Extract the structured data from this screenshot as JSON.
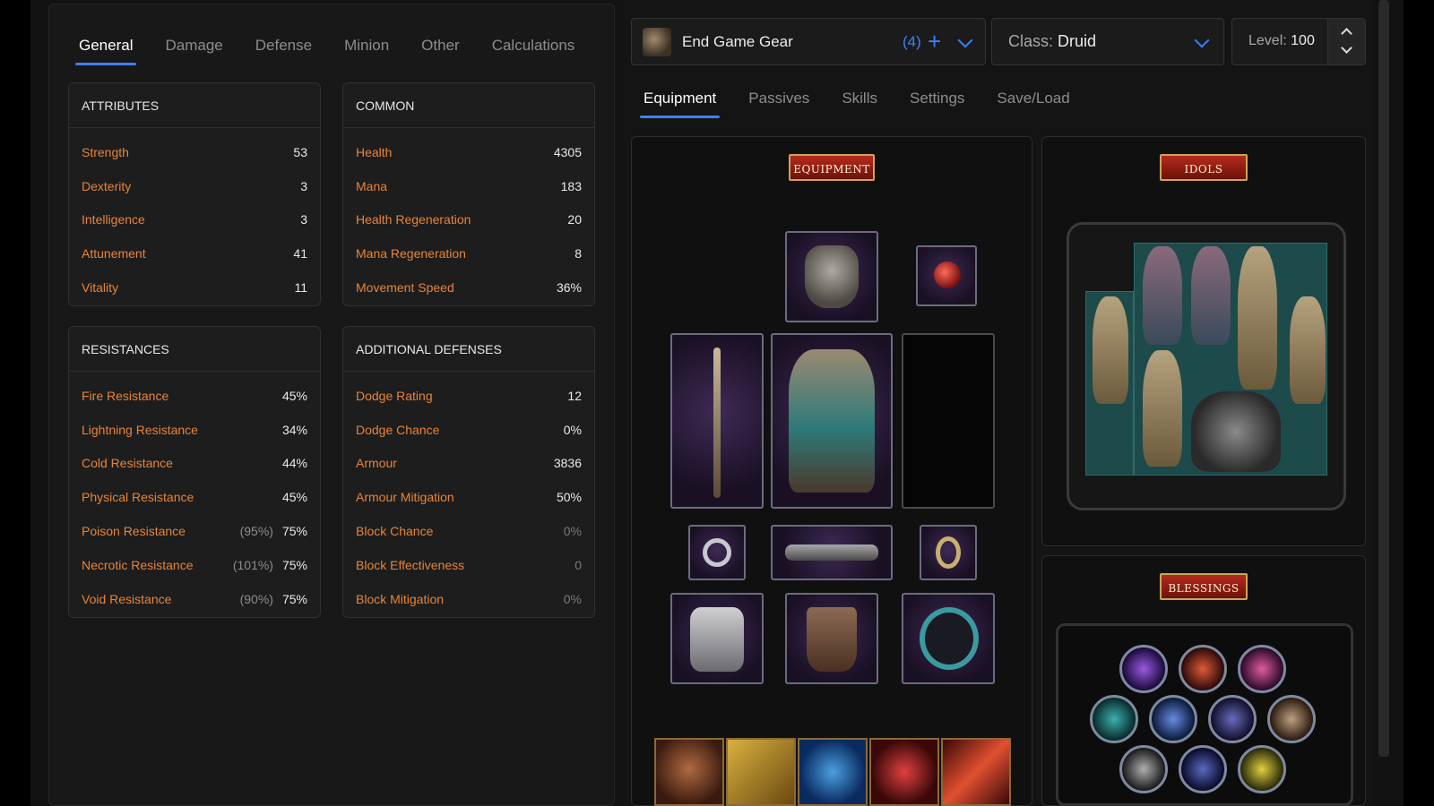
{
  "left_tabs": [
    "General",
    "Damage",
    "Defense",
    "Minion",
    "Other",
    "Calculations"
  ],
  "attributes": {
    "title": "ATTRIBUTES",
    "rows": [
      {
        "label": "Strength",
        "value": "53"
      },
      {
        "label": "Dexterity",
        "value": "3"
      },
      {
        "label": "Intelligence",
        "value": "3"
      },
      {
        "label": "Attunement",
        "value": "41"
      },
      {
        "label": "Vitality",
        "value": "11"
      }
    ]
  },
  "common": {
    "title": "COMMON",
    "rows": [
      {
        "label": "Health",
        "value": "4305"
      },
      {
        "label": "Mana",
        "value": "183"
      },
      {
        "label": "Health Regeneration",
        "value": "20"
      },
      {
        "label": "Mana Regeneration",
        "value": "8"
      },
      {
        "label": "Movement Speed",
        "value": "36%"
      }
    ]
  },
  "resistances": {
    "title": "RESISTANCES",
    "rows": [
      {
        "label": "Fire Resistance",
        "extra": "",
        "value": "45%"
      },
      {
        "label": "Lightning Resistance",
        "extra": "",
        "value": "34%"
      },
      {
        "label": "Cold Resistance",
        "extra": "",
        "value": "44%"
      },
      {
        "label": "Physical Resistance",
        "extra": "",
        "value": "45%"
      },
      {
        "label": "Poison Resistance",
        "extra": "(95%)",
        "value": "75%"
      },
      {
        "label": "Necrotic Resistance",
        "extra": "(101%)",
        "value": "75%"
      },
      {
        "label": "Void Resistance",
        "extra": "(90%)",
        "value": "75%"
      }
    ]
  },
  "additional_defenses": {
    "title": "ADDITIONAL DEFENSES",
    "rows": [
      {
        "label": "Dodge Rating",
        "value": "12"
      },
      {
        "label": "Dodge Chance",
        "value": "0%"
      },
      {
        "label": "Armour",
        "value": "3836"
      },
      {
        "label": "Armour Mitigation",
        "value": "50%"
      },
      {
        "label": "Block Chance",
        "value": "0%"
      },
      {
        "label": "Block Effectiveness",
        "value": "0"
      },
      {
        "label": "Block Mitigation",
        "value": "0%"
      }
    ]
  },
  "gear_set": {
    "name": "End Game Gear",
    "count": "(4)"
  },
  "class_select": {
    "prefix": "Class: ",
    "value": "Druid"
  },
  "level": {
    "prefix": "Level: ",
    "value": "100"
  },
  "right_tabs": [
    "Equipment",
    "Passives",
    "Skills",
    "Settings",
    "Save/Load"
  ],
  "banners": {
    "equipment": "EQUIPMENT",
    "idols": "IDOLS",
    "blessings": "BLESSINGS"
  },
  "colors": {
    "accent": "#3b82f6",
    "stat_label": "#e8843a"
  }
}
